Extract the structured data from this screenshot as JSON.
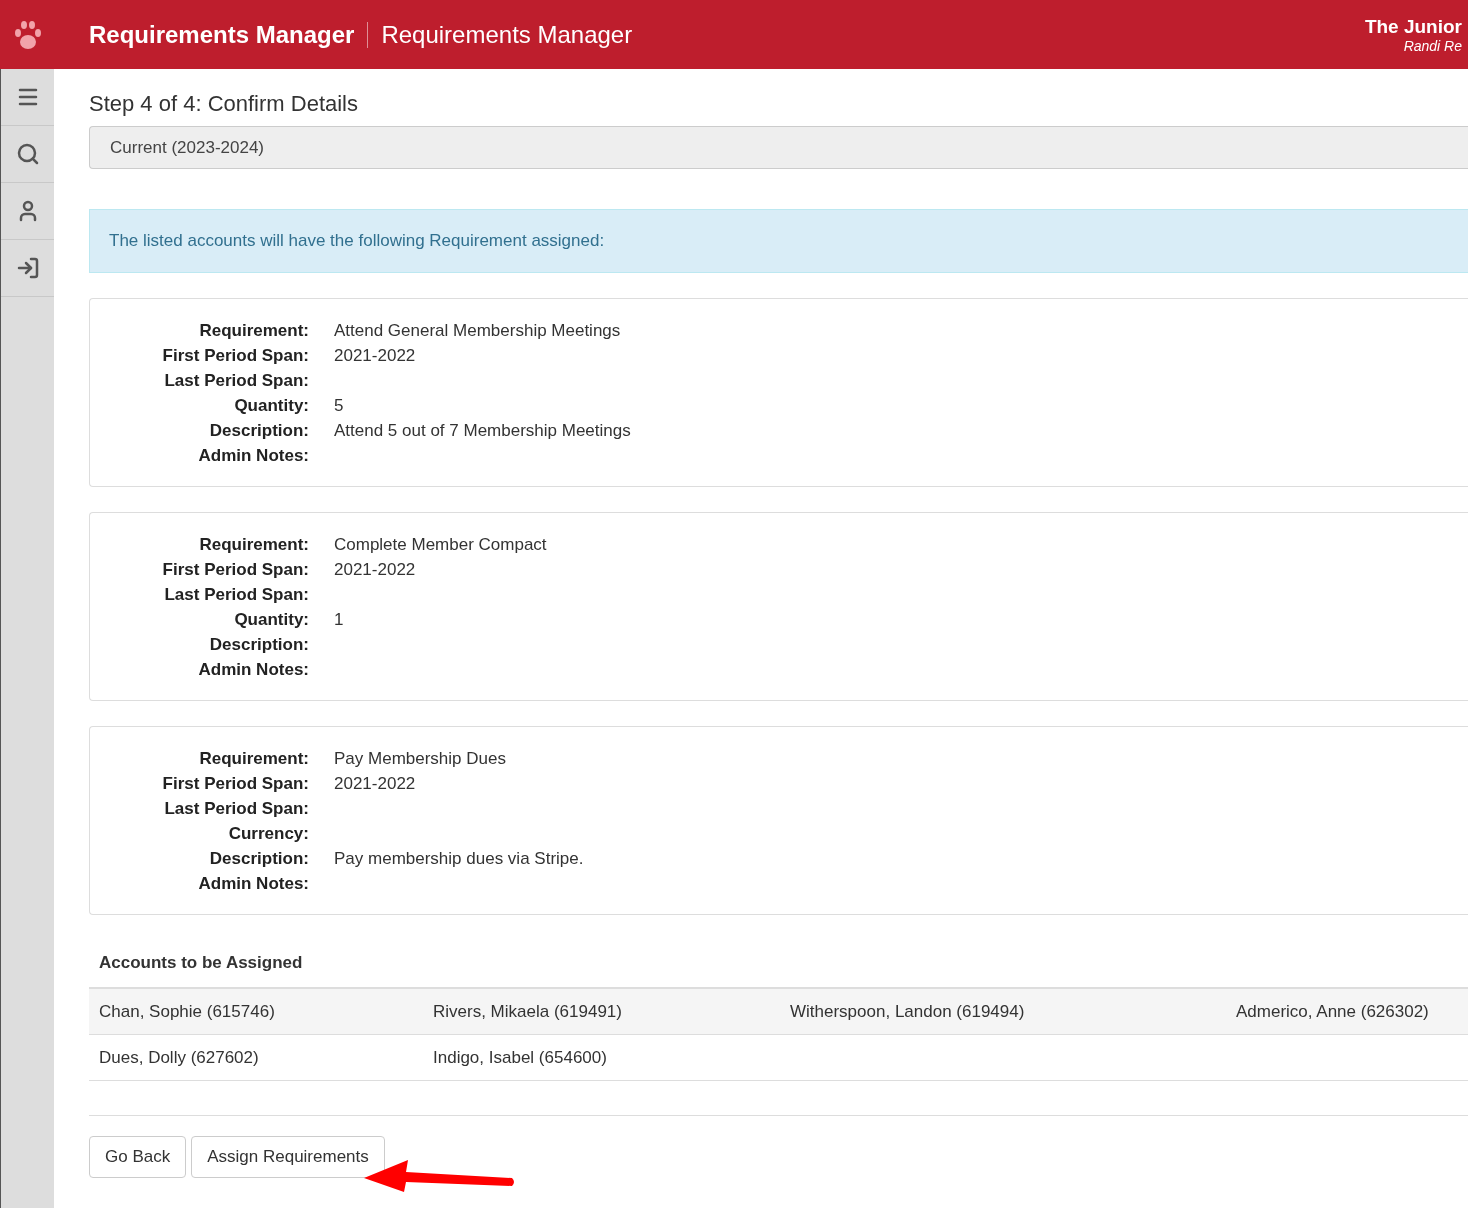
{
  "header": {
    "app_title": "Requirements Manager",
    "page_title": "Requirements Manager",
    "org": "The Junior",
    "user": "Randi Re"
  },
  "step_title": "Step 4 of 4: Confirm Details",
  "period": "Current (2023-2024)",
  "alert": "The listed accounts will have the following Requirement assigned:",
  "requirements": [
    {
      "fields": [
        {
          "label": "Requirement:",
          "value": "Attend General Membership Meetings"
        },
        {
          "label": "First Period Span:",
          "value": "2021-2022"
        },
        {
          "label": "Last Period Span:"
        },
        {
          "label": "Quantity:",
          "value": "5"
        },
        {
          "label": "Description:",
          "value": "Attend 5 out of 7 Membership Meetings"
        },
        {
          "label": "Admin Notes:"
        }
      ]
    },
    {
      "fields": [
        {
          "label": "Requirement:",
          "value": "Complete Member Compact"
        },
        {
          "label": "First Period Span:",
          "value": "2021-2022"
        },
        {
          "label": "Last Period Span:"
        },
        {
          "label": "Quantity:",
          "value": "1"
        },
        {
          "label": "Description:"
        },
        {
          "label": "Admin Notes:"
        }
      ]
    },
    {
      "fields": [
        {
          "label": "Requirement:",
          "value": "Pay Membership Dues"
        },
        {
          "label": "First Period Span:",
          "value": "2021-2022"
        },
        {
          "label": "Last Period Span:"
        },
        {
          "label": "Currency:"
        },
        {
          "label": "Description:",
          "value": "Pay membership dues via Stripe."
        },
        {
          "label": "Admin Notes:"
        }
      ]
    }
  ],
  "accounts": {
    "title": "Accounts to be Assigned",
    "rows": [
      [
        "Chan, Sophie (615746)",
        "Rivers, Mikaela (619491)",
        "Witherspoon, Landon (619494)",
        "Admerico, Anne (626302)"
      ],
      [
        "Dues, Dolly (627602)",
        "Indigo, Isabel (654600)"
      ]
    ]
  },
  "buttons": [
    {
      "label": "Go Back"
    },
    {
      "label": "Assign Requirements"
    }
  ]
}
